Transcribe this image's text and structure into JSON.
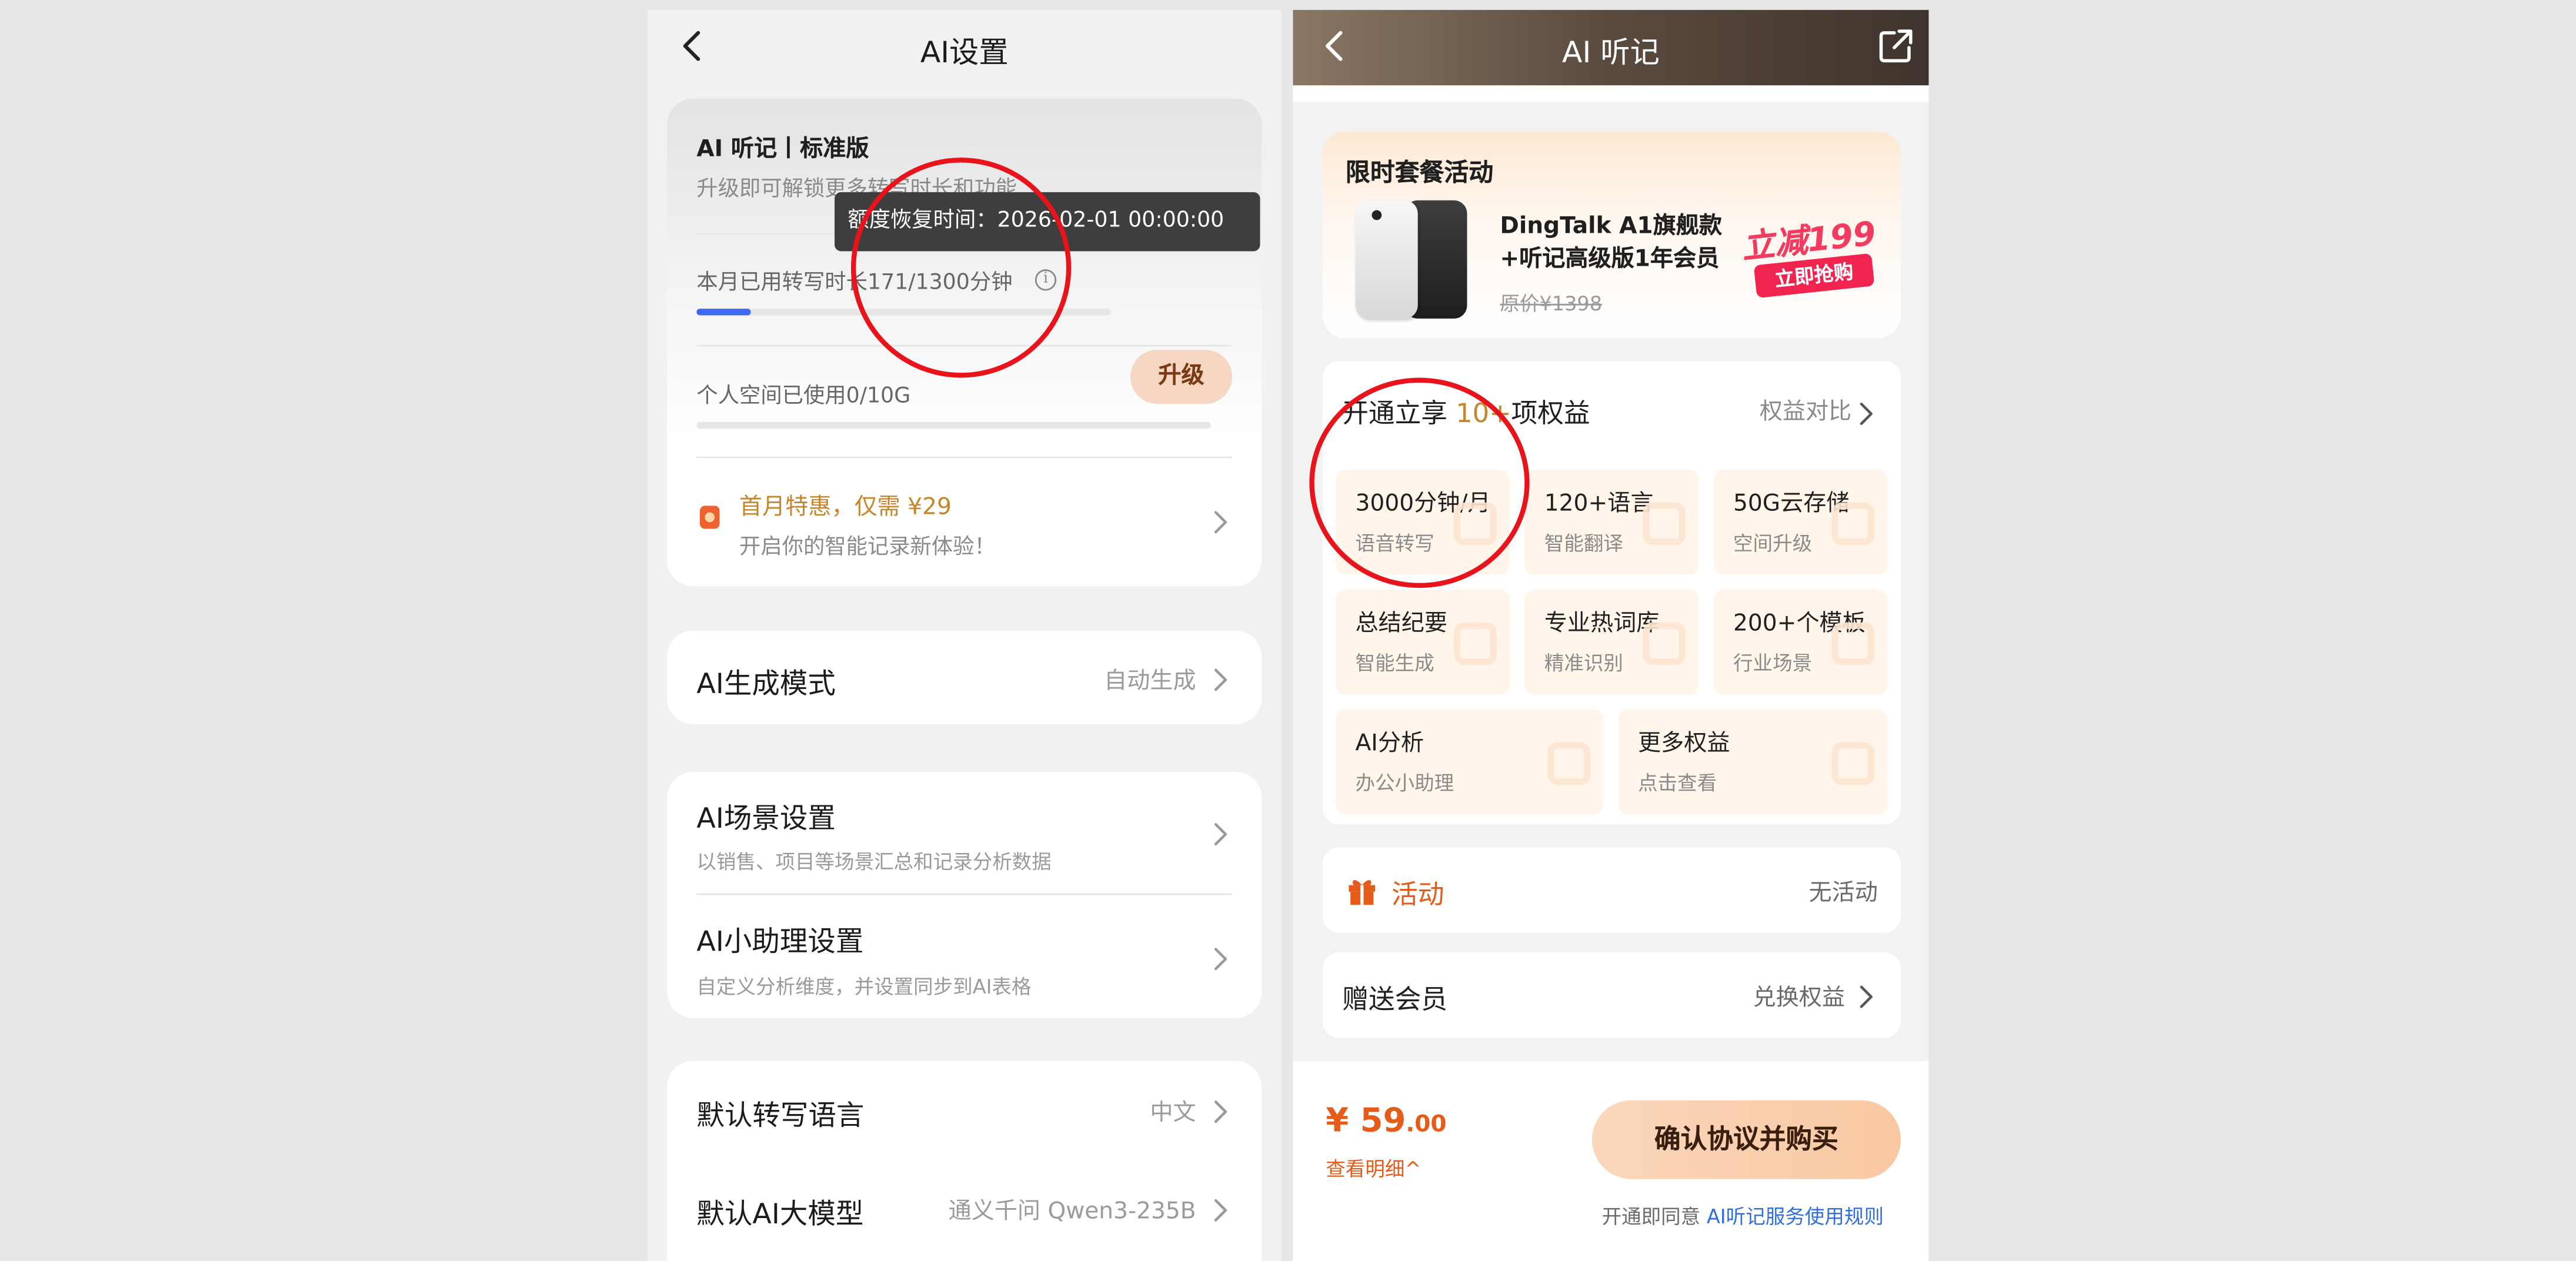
{
  "left": {
    "title": "AI设置",
    "plan": {
      "name": "AI 听记丨标准版",
      "subtitle": "升级即可解锁更多转写时长和功能"
    },
    "usage": {
      "label": "本月已用转写时长171/1300分钟",
      "used_minutes": 171,
      "total_minutes": 1300,
      "info_icon": "info-icon"
    },
    "upgrade_label": "升级",
    "storage": {
      "label": "个人空间已使用0/10G",
      "used": 0,
      "total": 10
    },
    "promo": {
      "title": "首月特惠，仅需 ¥29",
      "subtitle": "开启你的智能记录新体验！"
    },
    "tooltip": "额度恢复时间：2026-02-01 00:00:00",
    "rows": {
      "ai_mode": {
        "title": "AI生成模式",
        "value": "自动生成"
      },
      "ai_scene": {
        "title": "AI场景设置",
        "subtitle": "以销售、项目等场景汇总和记录分析数据"
      },
      "ai_assistant": {
        "title": "AI小助理设置",
        "subtitle": "自定义分析维度，并设置同步到AI表格"
      },
      "lang": {
        "title": "默认转写语言",
        "value": "中文"
      },
      "model": {
        "title": "默认AI大模型",
        "value": "通义千问 Qwen3-235B"
      }
    }
  },
  "right": {
    "title": "AI 听记",
    "limited": {
      "title": "限时套餐活动",
      "product_line1": "DingTalk A1旗舰款",
      "product_line2": "+听记高级版1年会员",
      "original_price": "原价¥1398",
      "badge_top": "立减199",
      "badge_btn": "立即抢购"
    },
    "benefits": {
      "title_prefix": "开通立享 ",
      "title_highlight": "10+",
      "title_suffix": "项权益",
      "compare": "权益对比",
      "tiles": [
        {
          "t1": "3000分钟/月",
          "t2": "语音转写"
        },
        {
          "t1": "120+语言",
          "t2": "智能翻译"
        },
        {
          "t1": "50G云存储",
          "t2": "空间升级"
        },
        {
          "t1": "总结纪要",
          "t2": "智能生成"
        },
        {
          "t1": "专业热词库",
          "t2": "精准识别"
        },
        {
          "t1": "200+个模板",
          "t2": "行业场景"
        },
        {
          "t1": "AI分析",
          "t2": "办公小助理"
        },
        {
          "t1": "更多权益",
          "t2": "点击查看"
        }
      ]
    },
    "activity": {
      "label": "活动",
      "value": "无活动"
    },
    "gift": {
      "label": "赠送会员",
      "value": "兑换权益"
    },
    "price": {
      "main": "¥ 59",
      "cents": ".00"
    },
    "detail": "查看明细^",
    "buy": "确认协议并购买",
    "agree_prefix": "开通即同意 ",
    "agree_link": "AI听记服务使用规则"
  },
  "colors": {
    "accent": "#e55b19",
    "progress": "#3c6af0",
    "annotation_ring": "#e8131b",
    "gold": "#c7852a"
  }
}
